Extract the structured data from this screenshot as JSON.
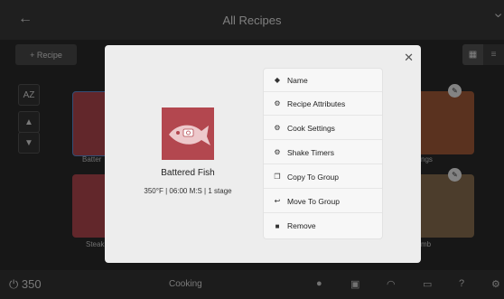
{
  "header": {
    "title": "All Recipes",
    "back_icon": "arrow-left-icon"
  },
  "toolbar": {
    "add_recipe": "+ Recipe",
    "sort_label": "AZ"
  },
  "background_tiles": [
    {
      "label": "Batter"
    },
    {
      "label": "ngs"
    },
    {
      "label": "Steak"
    },
    {
      "label": "mb"
    }
  ],
  "modal": {
    "recipe_name": "Battered Fish",
    "recipe_info": "350°F | 06:00 M:S | 1 stage",
    "menu": [
      {
        "label": "Name",
        "icon": "tag-icon"
      },
      {
        "label": "Recipe Attributes",
        "icon": "gear-icon"
      },
      {
        "label": "Cook Settings",
        "icon": "gear-icon"
      },
      {
        "label": "Shake Timers",
        "icon": "gear-icon"
      },
      {
        "label": "Copy To Group",
        "icon": "copy-icon"
      },
      {
        "label": "Move To Group",
        "icon": "reply-icon"
      },
      {
        "label": "Remove",
        "icon": "trash-icon"
      }
    ]
  },
  "bottombar": {
    "temperature": "350",
    "status": "Cooking"
  },
  "colors": {
    "accent": "#b3474f",
    "modal_bg": "#ededed"
  }
}
